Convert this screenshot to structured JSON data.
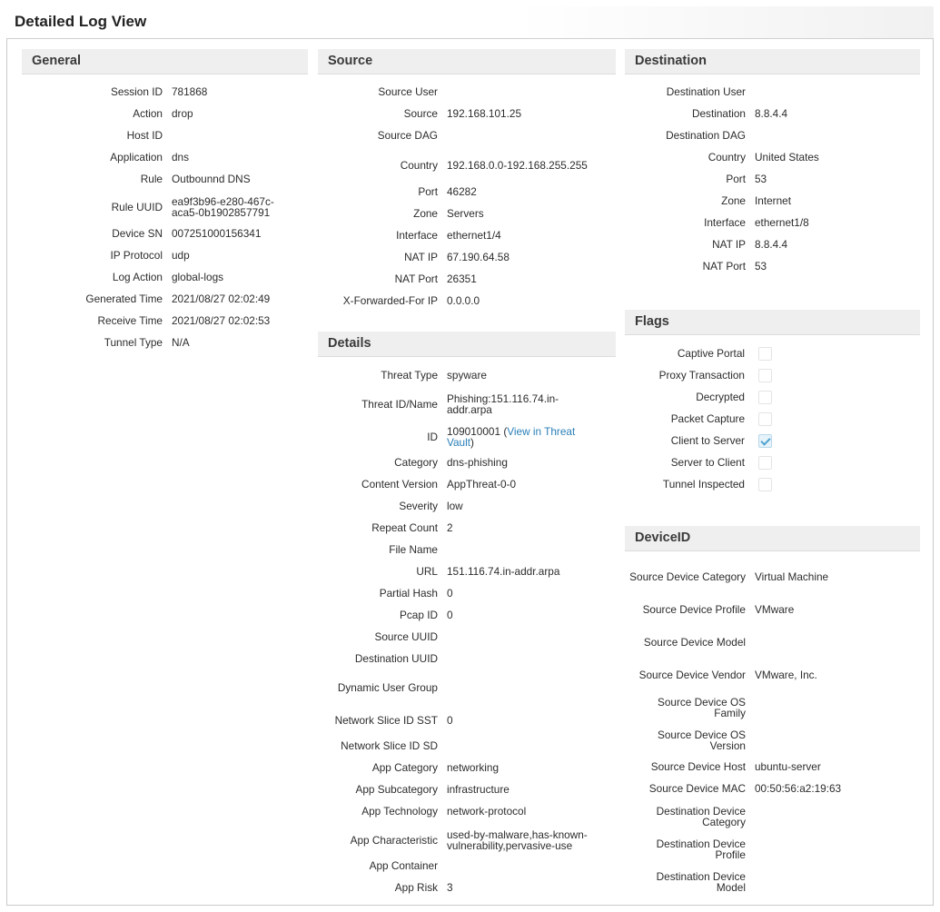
{
  "window": {
    "title": "Detailed Log View"
  },
  "general": {
    "header": "General",
    "rows": [
      {
        "label": "Session ID",
        "value": "781868"
      },
      {
        "label": "Action",
        "value": "drop"
      },
      {
        "label": "Host ID",
        "value": ""
      },
      {
        "label": "Application",
        "value": "dns"
      },
      {
        "label": "Rule",
        "value": "Outbounnd DNS"
      },
      {
        "label": "Rule UUID",
        "value": "ea9f3b96-e280-467c-aca5-0b1902857791"
      },
      {
        "label": "Device SN",
        "value": "007251000156341"
      },
      {
        "label": "IP Protocol",
        "value": "udp"
      },
      {
        "label": "Log Action",
        "value": "global-logs"
      },
      {
        "label": "Generated Time",
        "value": "2021/08/27 02:02:49"
      },
      {
        "label": "Receive Time",
        "value": "2021/08/27 02:02:53"
      },
      {
        "label": "Tunnel Type",
        "value": "N/A"
      }
    ]
  },
  "source": {
    "header": "Source",
    "rows": [
      {
        "label": "Source User",
        "value": ""
      },
      {
        "label": "Source",
        "value": "192.168.101.25"
      },
      {
        "label": "Source DAG",
        "value": ""
      },
      {
        "label": "Country",
        "value": "192.168.0.0-192.168.255.255"
      },
      {
        "label": "Port",
        "value": "46282"
      },
      {
        "label": "Zone",
        "value": "Servers"
      },
      {
        "label": "Interface",
        "value": "ethernet1/4"
      },
      {
        "label": "NAT IP",
        "value": "67.190.64.58"
      },
      {
        "label": "NAT Port",
        "value": "26351"
      },
      {
        "label": "X-Forwarded-For IP",
        "value": "0.0.0.0"
      }
    ]
  },
  "details": {
    "header": "Details",
    "rows": [
      {
        "label": "Threat Type",
        "value": "spyware"
      },
      {
        "label": "Threat ID/Name",
        "value": "Phishing:151.116.74.in-addr.arpa"
      },
      {
        "label": "ID",
        "value": "109010001",
        "link_open": " (",
        "link": "View in Threat Vault",
        "link_close": ")"
      },
      {
        "label": "Category",
        "value": "dns-phishing"
      },
      {
        "label": "Content Version",
        "value": "AppThreat-0-0"
      },
      {
        "label": "Severity",
        "value": "low"
      },
      {
        "label": "Repeat Count",
        "value": "2"
      },
      {
        "label": "File Name",
        "value": ""
      },
      {
        "label": "URL",
        "value": "151.116.74.in-addr.arpa"
      },
      {
        "label": "Partial Hash",
        "value": "0"
      },
      {
        "label": "Pcap ID",
        "value": "0"
      },
      {
        "label": "Source UUID",
        "value": ""
      },
      {
        "label": "Destination UUID",
        "value": ""
      },
      {
        "label": "Dynamic User Group",
        "value": ""
      },
      {
        "label": "Network Slice ID SST",
        "value": "0"
      },
      {
        "label": "Network Slice ID SD",
        "value": ""
      },
      {
        "label": "App Category",
        "value": "networking"
      },
      {
        "label": "App Subcategory",
        "value": "infrastructure"
      },
      {
        "label": "App Technology",
        "value": "network-protocol"
      },
      {
        "label": "App Characteristic",
        "value": "used-by-malware,has-known-vulnerability,pervasive-use"
      },
      {
        "label": "App Container",
        "value": ""
      },
      {
        "label": "App Risk",
        "value": "3"
      }
    ]
  },
  "destination": {
    "header": "Destination",
    "rows": [
      {
        "label": "Destination User",
        "value": ""
      },
      {
        "label": "Destination",
        "value": "8.8.4.4"
      },
      {
        "label": "Destination DAG",
        "value": ""
      },
      {
        "label": "Country",
        "value": "United States"
      },
      {
        "label": "Port",
        "value": "53"
      },
      {
        "label": "Zone",
        "value": "Internet"
      },
      {
        "label": "Interface",
        "value": "ethernet1/8"
      },
      {
        "label": "NAT IP",
        "value": "8.8.4.4"
      },
      {
        "label": "NAT Port",
        "value": "53"
      }
    ]
  },
  "flags": {
    "header": "Flags",
    "rows": [
      {
        "label": "Captive Portal",
        "checked": false
      },
      {
        "label": "Proxy Transaction",
        "checked": false
      },
      {
        "label": "Decrypted",
        "checked": false
      },
      {
        "label": "Packet Capture",
        "checked": false
      },
      {
        "label": "Client to Server",
        "checked": true
      },
      {
        "label": "Server to Client",
        "checked": false
      },
      {
        "label": "Tunnel Inspected",
        "checked": false
      }
    ]
  },
  "deviceid": {
    "header": "DeviceID",
    "rows": [
      {
        "label": "Source Device Category",
        "value": "Virtual Machine"
      },
      {
        "label": "Source Device Profile",
        "value": "VMware"
      },
      {
        "label": "Source Device Model",
        "value": ""
      },
      {
        "label": "Source Device Vendor",
        "value": "VMware, Inc."
      },
      {
        "label": "Source Device OS Family",
        "value": ""
      },
      {
        "label": "Source Device OS Version",
        "value": ""
      },
      {
        "label": "Source Device Host",
        "value": "ubuntu-server"
      },
      {
        "label": "Source Device MAC",
        "value": "00:50:56:a2:19:63"
      },
      {
        "label": "Destination Device Category",
        "value": ""
      },
      {
        "label": "Destination Device Profile",
        "value": ""
      },
      {
        "label": "Destination Device Model",
        "value": ""
      }
    ]
  }
}
